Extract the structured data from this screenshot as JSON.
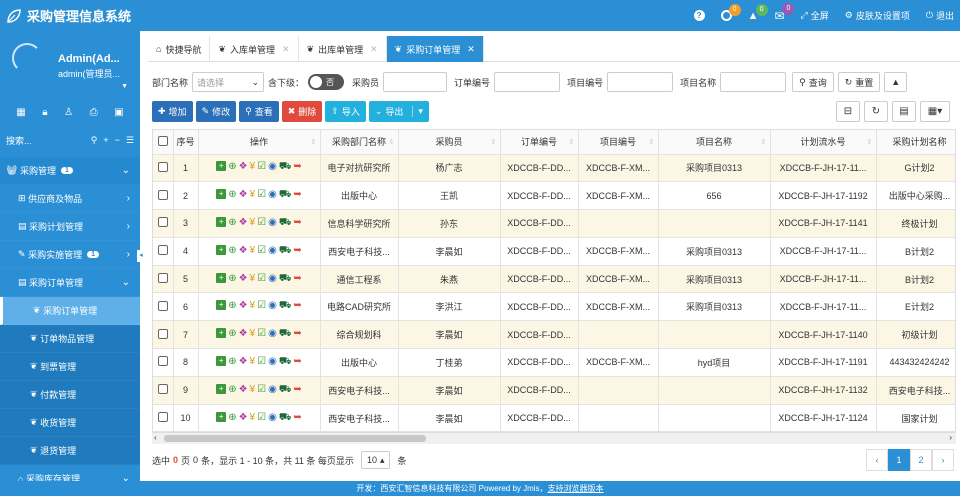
{
  "header": {
    "title": "采购管理信息系统",
    "items": [
      {
        "label": ""
      },
      {
        "label": "",
        "badge": "0",
        "badge_color": "#f0a02a"
      },
      {
        "label": "",
        "badge": "0",
        "badge_color": "#5cb85c"
      },
      {
        "label": "",
        "badge": "0",
        "badge_color": "#9b59b6"
      },
      {
        "label": "全屏"
      },
      {
        "label": "皮肤及设置项"
      },
      {
        "label": "退出"
      }
    ]
  },
  "user": {
    "name": "Admin(Ad...",
    "role": "admin(管理员..."
  },
  "sidebar": {
    "search_placeholder": "搜索...",
    "menu": [
      {
        "label": "采购管理",
        "count": "1",
        "level": "top"
      },
      {
        "label": "供应商及物品",
        "level": "sub"
      },
      {
        "label": "采购计划管理",
        "level": "sub"
      },
      {
        "label": "采购实施管理",
        "count": "1",
        "level": "sub"
      },
      {
        "label": "采购订单管理",
        "level": "sub"
      },
      {
        "label": "采购订单管理",
        "level": "sub2",
        "active": true
      },
      {
        "label": "订单物品管理",
        "level": "sub2"
      },
      {
        "label": "到票管理",
        "level": "sub2"
      },
      {
        "label": "付款管理",
        "level": "sub2"
      },
      {
        "label": "收货管理",
        "level": "sub2"
      },
      {
        "label": "退货管理",
        "level": "sub2"
      },
      {
        "label": "采购库存管理",
        "level": "sub"
      }
    ]
  },
  "tabs": [
    {
      "label": "快捷导航",
      "closable": false
    },
    {
      "label": "入库单管理",
      "closable": true
    },
    {
      "label": "出库单管理",
      "closable": true
    },
    {
      "label": "采购订单管理",
      "closable": true,
      "active": true
    }
  ],
  "filters": {
    "dept_label": "部门名称",
    "dept_placeholder": "请选择",
    "sub_label": "含下级：",
    "toggle": "否",
    "buyer_label": "采购员",
    "order_label": "订单编号",
    "proj_no_label": "项目编号",
    "proj_name_label": "项目名称",
    "query": "查询",
    "reset": "重置"
  },
  "toolbar": {
    "add": "增加",
    "edit": "修改",
    "view": "查看",
    "delete": "删除",
    "import": "导入",
    "export": "导出"
  },
  "table": {
    "headers": [
      "序号",
      "操作",
      "采购部门名称",
      "采购员",
      "订单编号",
      "项目编号",
      "项目名称",
      "计划流水号",
      "采购计划名称"
    ],
    "rows": [
      [
        "1",
        "电子对抗研究所",
        "杨广志",
        "XDCCB-F-DD...",
        "XDCCB-F-XM...",
        "采购项目0313",
        "XDCCB-F-JH-17-11...",
        "G计划2"
      ],
      [
        "2",
        "出版中心",
        "王凯",
        "XDCCB-F-DD...",
        "XDCCB-F-XM...",
        "656",
        "XDCCB-F-JH-17-1192",
        "出版中心采购..."
      ],
      [
        "3",
        "信息科学研究所",
        "孙东",
        "XDCCB-F-DD...",
        "",
        "",
        "XDCCB-F-JH-17-1141",
        "终极计划"
      ],
      [
        "4",
        "西安电子科技...",
        "李晨如",
        "XDCCB-F-DD...",
        "XDCCB-F-XM...",
        "采购项目0313",
        "XDCCB-F-JH-17-11...",
        "B计划2"
      ],
      [
        "5",
        "通信工程系",
        "朱燕",
        "XDCCB-F-DD...",
        "XDCCB-F-XM...",
        "采购项目0313",
        "XDCCB-F-JH-17-11...",
        "B计划2"
      ],
      [
        "6",
        "电路CAD研究所",
        "李洪江",
        "XDCCB-F-DD...",
        "XDCCB-F-XM...",
        "采购项目0313",
        "XDCCB-F-JH-17-11...",
        "E计划2"
      ],
      [
        "7",
        "综合规划科",
        "李晨如",
        "XDCCB-F-DD...",
        "",
        "",
        "XDCCB-F-JH-17-1140",
        "初级计划"
      ],
      [
        "8",
        "出版中心",
        "丁桂弟",
        "XDCCB-F-DD...",
        "XDCCB-F-XM...",
        "hyd项目",
        "XDCCB-F-JH-17-1191",
        "443432424242"
      ],
      [
        "9",
        "西安电子科技...",
        "李晨如",
        "XDCCB-F-DD...",
        "",
        "",
        "XDCCB-F-JH-17-1132",
        "西安电子科技..."
      ],
      [
        "10",
        "西安电子科技...",
        "李晨如",
        "XDCCB-F-DD...",
        "",
        "",
        "XDCCB-F-JH-17-1124",
        "国家计划"
      ]
    ]
  },
  "pager": {
    "p1": "选中",
    "selected": "0",
    "p2": "页",
    "p3": "0",
    "p4": "条，显示 1 - 10 条，共 11 条 每页显示",
    "size": "10",
    "p5": "条",
    "prev": "‹",
    "page1": "1",
    "page2": "2",
    "next": "›"
  },
  "footer": {
    "text": "开发：西安汇智信息科技有限公司 Powered by Jmis，",
    "link": "支持浏览器版本"
  }
}
